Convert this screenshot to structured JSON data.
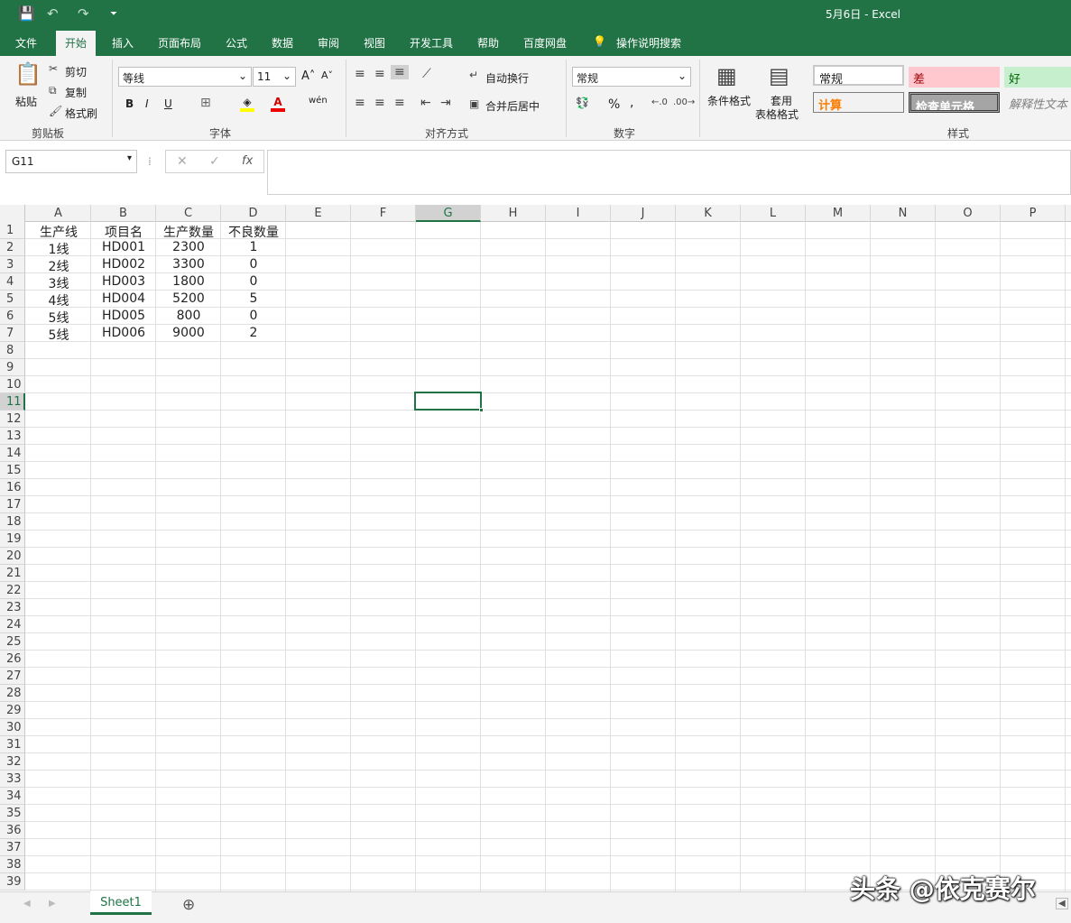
{
  "title": {
    "text": "5月6日  -  Excel"
  },
  "qa": {
    "save": "💾",
    "undo": "↶",
    "redo": "↷",
    "more": "⏷"
  },
  "menu": {
    "file": "文件",
    "home": "开始",
    "insert": "插入",
    "layout": "页面布局",
    "formulas": "公式",
    "data": "数据",
    "review": "审阅",
    "view": "视图",
    "developer": "开发工具",
    "help": "帮助",
    "baidu": "百度网盘",
    "tellme": "操作说明搜索"
  },
  "clipboard": {
    "paste": "粘贴",
    "cut": "剪切",
    "copy": "复制",
    "format_painter": "格式刷",
    "group": "剪贴板"
  },
  "font": {
    "name": "等线",
    "size": "11",
    "grow": "A˄",
    "shrink": "A˅",
    "bold": "B",
    "italic": "I",
    "underline": "U",
    "border": "⊞",
    "fill": "A",
    "wen": "wén",
    "group": "字体"
  },
  "align": {
    "wrap": "自动换行",
    "merge": "合并后居中",
    "group": "对齐方式"
  },
  "number": {
    "format": "常规",
    "percent": "%",
    "comma": ",",
    "group": "数字"
  },
  "styles": {
    "cond": "条件格式",
    "table1": "套用",
    "table2": "表格格式",
    "normal": "常规",
    "bad": "差",
    "good": "好",
    "calc": "计算",
    "check": "检查单元格",
    "explain": "解释性文本",
    "group": "样式"
  },
  "formulabar": {
    "namebox": "G11",
    "cancel": "✕",
    "enter": "✓",
    "fx": "fx",
    "value": ""
  },
  "columns": [
    "A",
    "B",
    "C",
    "D",
    "E",
    "F",
    "G",
    "H",
    "I",
    "J",
    "K",
    "L",
    "M",
    "N",
    "O",
    "P"
  ],
  "selected_col": "G",
  "selected_row": "11",
  "rows": [
    "1",
    "2",
    "3",
    "4",
    "5",
    "6",
    "7",
    "8",
    "9",
    "10",
    "11",
    "12",
    "13",
    "14",
    "15",
    "16",
    "17",
    "18",
    "19",
    "20",
    "21",
    "22",
    "23",
    "24",
    "25",
    "26",
    "27",
    "28",
    "29",
    "30",
    "31",
    "32",
    "33",
    "34",
    "35",
    "36",
    "37",
    "38",
    "39"
  ],
  "table": [
    [
      "生产线",
      "项目名",
      "生产数量",
      "不良数量"
    ],
    [
      "1线",
      "HD001",
      "2300",
      "1"
    ],
    [
      "2线",
      "HD002",
      "3300",
      "0"
    ],
    [
      "3线",
      "HD003",
      "1800",
      "0"
    ],
    [
      "4线",
      "HD004",
      "5200",
      "5"
    ],
    [
      "5线",
      "HD005",
      "800",
      "0"
    ],
    [
      "5线",
      "HD006",
      "9000",
      "2"
    ]
  ],
  "sheets": {
    "active": "Sheet1",
    "add": "⊕"
  },
  "watermark": "头条 @依克赛尔"
}
